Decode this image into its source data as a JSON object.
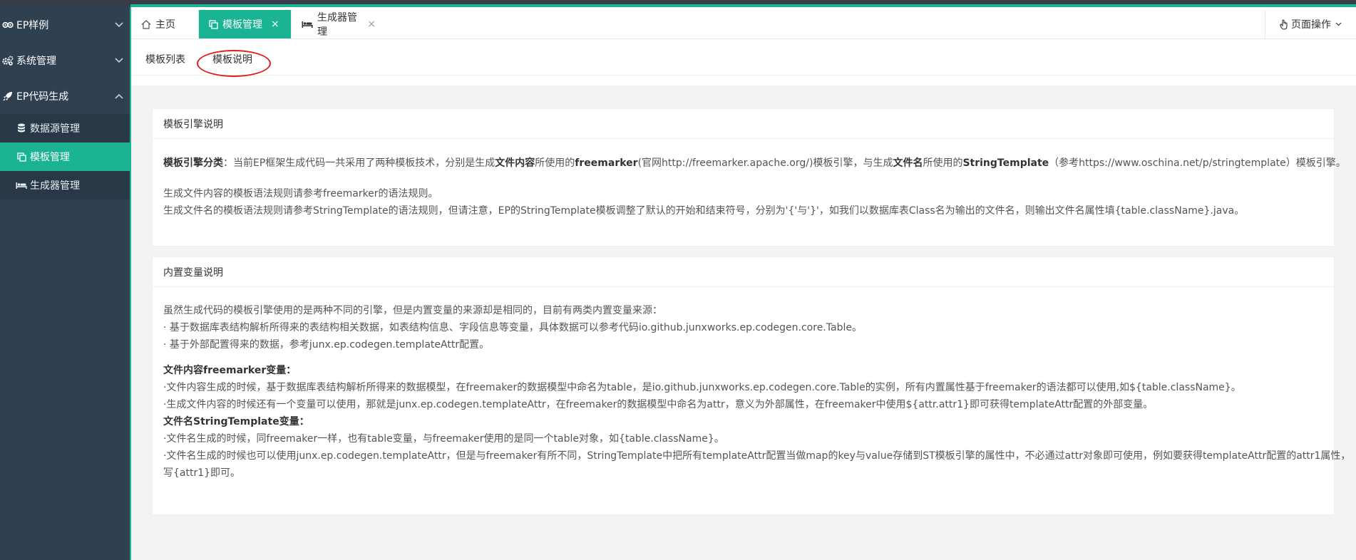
{
  "sidebar": {
    "groups": [
      {
        "label": "EP样例",
        "icon": "eye-icon",
        "chevron": "down"
      },
      {
        "label": "系统管理",
        "icon": "gears-icon",
        "chevron": "down"
      },
      {
        "label": "EP代码生成",
        "icon": "rocket-icon",
        "chevron": "up"
      }
    ],
    "items": [
      {
        "label": "数据源管理",
        "icon": "database-icon"
      },
      {
        "label": "模板管理",
        "icon": "copy-icon",
        "active": true
      },
      {
        "label": "生成器管理",
        "icon": "bed-icon"
      }
    ]
  },
  "tabs": [
    {
      "label": "主页",
      "icon": "home-icon",
      "closable": false
    },
    {
      "label": "模板管理",
      "icon": "copy-icon",
      "closable": true,
      "active": true
    },
    {
      "label": "生成器管理",
      "icon": "bed-icon",
      "closable": true
    }
  ],
  "tab_close_glyph": "×",
  "page_ops": {
    "label": "页面操作",
    "icon": "hand-icon"
  },
  "subtabs": [
    "模板列表",
    "模板说明"
  ],
  "panel1": {
    "title": "模板引擎说明",
    "l1_b1": "模板引擎分类",
    "l1_t1": "：当前EP框架生成代码一共采用了两种模板技术，分别是生成",
    "l1_b2": "文件内容",
    "l1_t2": "所使用的",
    "l1_b3": "freemarker",
    "l1_t3": "(官网http://freemarker.apache.org/)模板引擎，与生成",
    "l1_b4": "文件名",
    "l1_t4": "所使用的",
    "l1_b5": "StringTemplate",
    "l1_t5": "（参考https://www.oschina.net/p/stringtemplate）模板引擎。",
    "l2": "生成文件内容的模板语法规则请参考freemarker的语法规则。",
    "l3": "生成文件名的模板语法规则请参考StringTemplate的语法规则，但请注意，EP的StringTemplate模板调整了默认的开始和结束符号，分别为'{'与'}'，如我们以数据库表Class名为输出的文件名，则输出文件名属性填{table.className}.java。"
  },
  "panel2": {
    "title": "内置变量说明",
    "l1": "虽然生成代码的模板引擎使用的是两种不同的引擎，但是内置变量的来源却是相同的，目前有两类内置变量来源：",
    "l2": "· 基于数据库表结构解析所得来的表结构相关数据，如表结构信息、字段信息等变量，具体数据可以参考代码io.github.junxworks.ep.codegen.core.Table。",
    "l3": "· 基于外部配置得来的数据，参考junx.ep.codegen.templateAttr配置。",
    "h1": "文件内容freemarker变量：",
    "l4": "·文件内容生成的时候，基于数据库表结构解析所得来的数据模型，在freemaker的数据模型中命名为table，是io.github.junxworks.ep.codegen.core.Table的实例，所有内置属性基于freemaker的语法都可以使用,如${table.className}。",
    "l5": "·生成文件内容的时候还有一个变量可以使用，那就是junx.ep.codegen.templateAttr，在freemaker的数据模型中命名为attr，意义为外部属性，在freemaker中使用${attr.attr1}即可获得templateAttr配置的外部变量。",
    "h2": "文件名StringTemplate变量：",
    "l6": "·文件名生成的时候，同freemaker一样，也有table变量，与freemaker使用的是同一个table对象，如{table.className}。",
    "l7": "·文件名生成的时候也可以使用junx.ep.codegen.templateAttr，但是与freemaker有所不同，StringTemplate中把所有templateAttr配置当做map的key与value存储到ST模板引擎的属性中，不必通过attr对象即可使用，例如要获得templateAttr配置的attr1属性，",
    "l8": "写{attr1}即可。"
  },
  "colors": {
    "accent": "#1ab394",
    "sidebar": "#2f4050",
    "highlight": "#e02020"
  }
}
